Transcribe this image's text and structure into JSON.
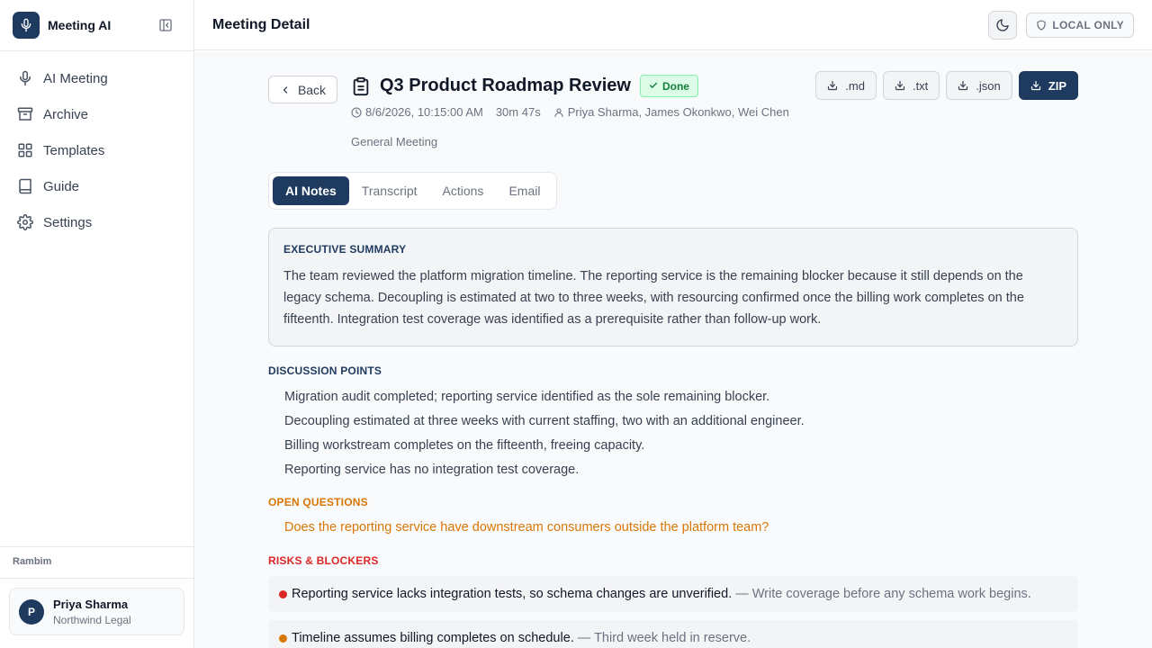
{
  "app": {
    "name": "Meeting AI",
    "page_title": "Meeting Detail",
    "privacy_badge": "LOCAL ONLY"
  },
  "sidebar": {
    "items": [
      {
        "label": "AI Meeting",
        "icon": "microphone-icon"
      },
      {
        "label": "Archive",
        "icon": "archive-icon"
      },
      {
        "label": "Templates",
        "icon": "grid-icon"
      },
      {
        "label": "Guide",
        "icon": "book-icon"
      },
      {
        "label": "Settings",
        "icon": "gear-icon"
      }
    ],
    "workspace": "Rambim",
    "user": {
      "initial": "P",
      "name": "Priya Sharma",
      "org": "Northwind Legal"
    }
  },
  "meeting": {
    "back_label": "Back",
    "title": "Q3 Product Roadmap Review",
    "status": "Done",
    "datetime": "8/6/2026, 10:15:00 AM",
    "duration": "30m 47s",
    "participants": "Priya Sharma, James Okonkwo, Wei Chen",
    "category": "General Meeting"
  },
  "exports": {
    "md": ".md",
    "txt": ".txt",
    "json": ".json",
    "zip": "ZIP"
  },
  "tabs": [
    "AI Notes",
    "Transcript",
    "Actions",
    "Email"
  ],
  "active_tab": "AI Notes",
  "notes": {
    "summary_heading": "EXECUTIVE SUMMARY",
    "summary": "The team reviewed the platform migration timeline. The reporting service is the remaining blocker because it still depends on the legacy schema. Decoupling is estimated at two to three weeks, with resourcing confirmed once the billing work completes on the fifteenth. Integration test coverage was identified as a prerequisite rather than follow-up work.",
    "discussion_heading": "DISCUSSION POINTS",
    "discussion_points": [
      "Migration audit completed; reporting service identified as the sole remaining blocker.",
      "Decoupling estimated at three weeks with current staffing, two with an additional engineer.",
      "Billing workstream completes on the fifteenth, freeing capacity.",
      "Reporting service has no integration test coverage."
    ],
    "questions_heading": "OPEN QUESTIONS",
    "open_questions": [
      "Does the reporting service have downstream consumers outside the platform team?"
    ],
    "risks_heading": "RISKS & BLOCKERS",
    "risks": [
      {
        "text": "Reporting service lacks integration tests, so schema changes are unverified.",
        "mitigation": "— Write coverage before any schema work begins.",
        "severity_color": "#dc2626"
      },
      {
        "text": "Timeline assumes billing completes on schedule.",
        "mitigation": "— Third week held in reserve.",
        "severity_color": "#d97706"
      }
    ]
  },
  "colors": {
    "brand": "#1e3a5f",
    "done_green": "#15803d",
    "orange": "#d97706",
    "red": "#dc2626"
  }
}
